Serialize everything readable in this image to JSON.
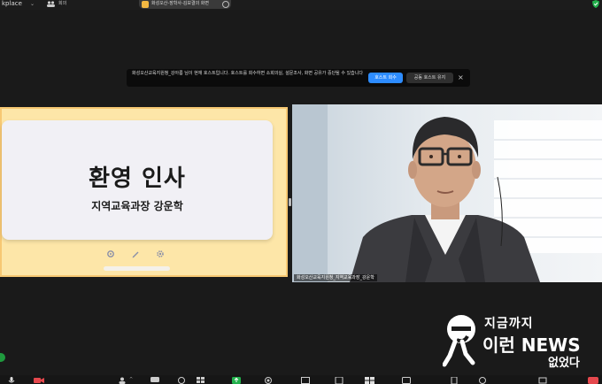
{
  "topbar": {
    "workspace_label": "kplace",
    "meeting_label": "회의",
    "share_label": "화성오산-장학사-김보결의 화면"
  },
  "notice": {
    "text": "화성오산교육지원청_강아름 님이 현재 호스트입니다. 호스트를 회수하면 소회의실, 설문조사, 화면 공유가 중단될 수 있습니다",
    "reclaim_button": "호스트 회수",
    "keep_button": "공동 호스트 유지"
  },
  "slide": {
    "title": "환영 인사",
    "subtitle": "지역교육과장 강운학"
  },
  "camera": {
    "name_label": "화성오산교육지원청_지역교육과장_강운학"
  },
  "watermark": {
    "line1": "지금까지",
    "line2": "이런 NEWS",
    "line3": "없었다"
  },
  "icons": [
    "chevron-down-icon",
    "meeting-icon",
    "lock-icon",
    "options-icon",
    "shield-icon",
    "settings-icon",
    "pen-icon",
    "gear-icon",
    "close-icon",
    "e-logo-icon",
    "mic-icon",
    "video-icon",
    "participants-icon",
    "chat-icon",
    "react-icon",
    "share-icon",
    "record-icon",
    "apps-icon",
    "more-icon",
    "leave-icon"
  ],
  "colors": {
    "accent": "#2d8cff",
    "slide_background": "#fde6a8",
    "slide_border": "#f7c873",
    "share_indicator": "#22b14c",
    "leave": "#e5484d"
  }
}
